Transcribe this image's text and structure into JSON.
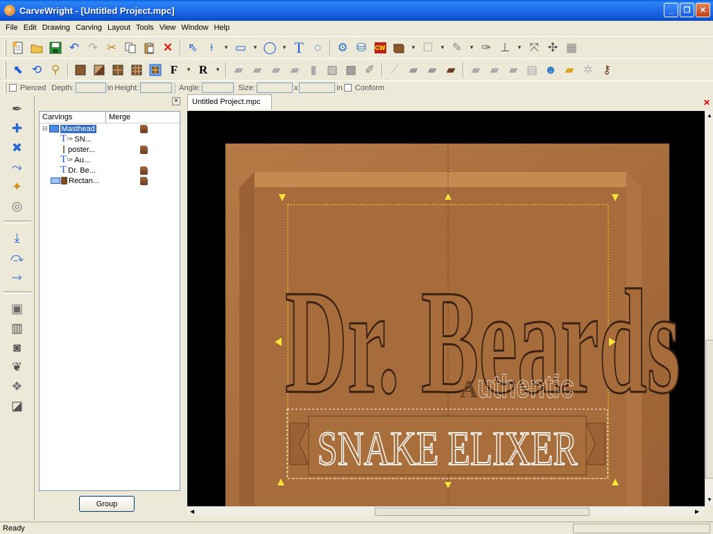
{
  "window": {
    "title": "CarveWright - [Untitled Project.mpc]",
    "accent": "#1E6BEA",
    "buttons": [
      "minimize",
      "restore",
      "close"
    ]
  },
  "menu": [
    "File",
    "Edit",
    "Drawing",
    "Carving",
    "Layout",
    "Tools",
    "View",
    "Window",
    "Help"
  ],
  "toolbar1": [
    "new-file-icon",
    "open-folder-icon",
    "save-icon",
    "undo-icon",
    "redo-icon",
    "cut-icon",
    "copy-icon",
    "paste-icon",
    "delete-icon",
    "select-arrow-icon",
    "polyline-icon",
    "rectangle-icon",
    "circle-icon",
    "text-icon",
    "outline-text-icon",
    "shell-icon",
    "bowl-icon",
    "cw-icon",
    "box-icon",
    "tray-icon",
    "feather-icon",
    "pattern-icon",
    "stamp-icon",
    "align-icon",
    "sweep-icon",
    "frame-icon"
  ],
  "toolbar2": [
    "select-cursor-icon",
    "lasso-icon",
    "zoom-icon",
    "board-icon",
    "diagonal-icon",
    "grid-a-icon",
    "grid-b-icon",
    "highlight-grid-icon",
    "font-f-icon",
    "font-r-icon",
    "bit-1-icon",
    "bit-2-icon",
    "bit-3-icon",
    "bit-4-icon",
    "bit-5-icon",
    "bit-6-icon",
    "bit-7-icon",
    "bit-8-icon",
    "wand-icon",
    "bit-9-icon",
    "bit-10-icon",
    "brown-bit-icon",
    "bit-11-icon",
    "bit-12-icon",
    "bit-13-icon",
    "doc-icon",
    "person-icon",
    "folder-icon",
    "cog-icon",
    "key-icon"
  ],
  "options": {
    "pierced_label": "Pierced",
    "depth_label": "Depth:",
    "depth_unit": "in",
    "height_label": "Height:",
    "angle_label": "Angle:",
    "size_label": "Size:",
    "size_x": "x",
    "size_unit": "in",
    "conform_label": "Conform"
  },
  "left_tools": [
    "pen-icon",
    "add-node-icon",
    "remove-node-icon",
    "curve-node-icon",
    "break-node-icon",
    "target-icon",
    "path-start-icon",
    "path-curve-icon",
    "path-end-icon",
    "emboss-icon",
    "columns-icon",
    "spiral-icon",
    "shape-icon",
    "roll-icon",
    "texture-icon"
  ],
  "panel": {
    "col_carvings": "Carvings",
    "col_merge": "Merge",
    "tree": [
      {
        "label": "Masthead",
        "level": 0,
        "selected": true,
        "merge": true
      },
      {
        "label": "SN...",
        "level": 1,
        "merge": false
      },
      {
        "label": "poster...",
        "level": 1,
        "merge": true
      },
      {
        "label": "Au...",
        "level": 1,
        "merge": false
      },
      {
        "label": "Dr. Be...",
        "level": 1,
        "merge": true
      },
      {
        "label": "Rectan...",
        "level": 0,
        "merge": true
      }
    ],
    "group_button": "Group"
  },
  "document": {
    "tab": "Untitled Project.mpc",
    "carving": {
      "line1": "Dr. Beards",
      "line2_initial": "A",
      "line2_rest": "uthentic",
      "line3": "SNAKE ELIXER"
    },
    "colors": {
      "board": "#A46A3A",
      "board_light": "#B57A46",
      "board_dark": "#7E4E26",
      "selection": "#FFE23A"
    }
  },
  "status": "Ready"
}
